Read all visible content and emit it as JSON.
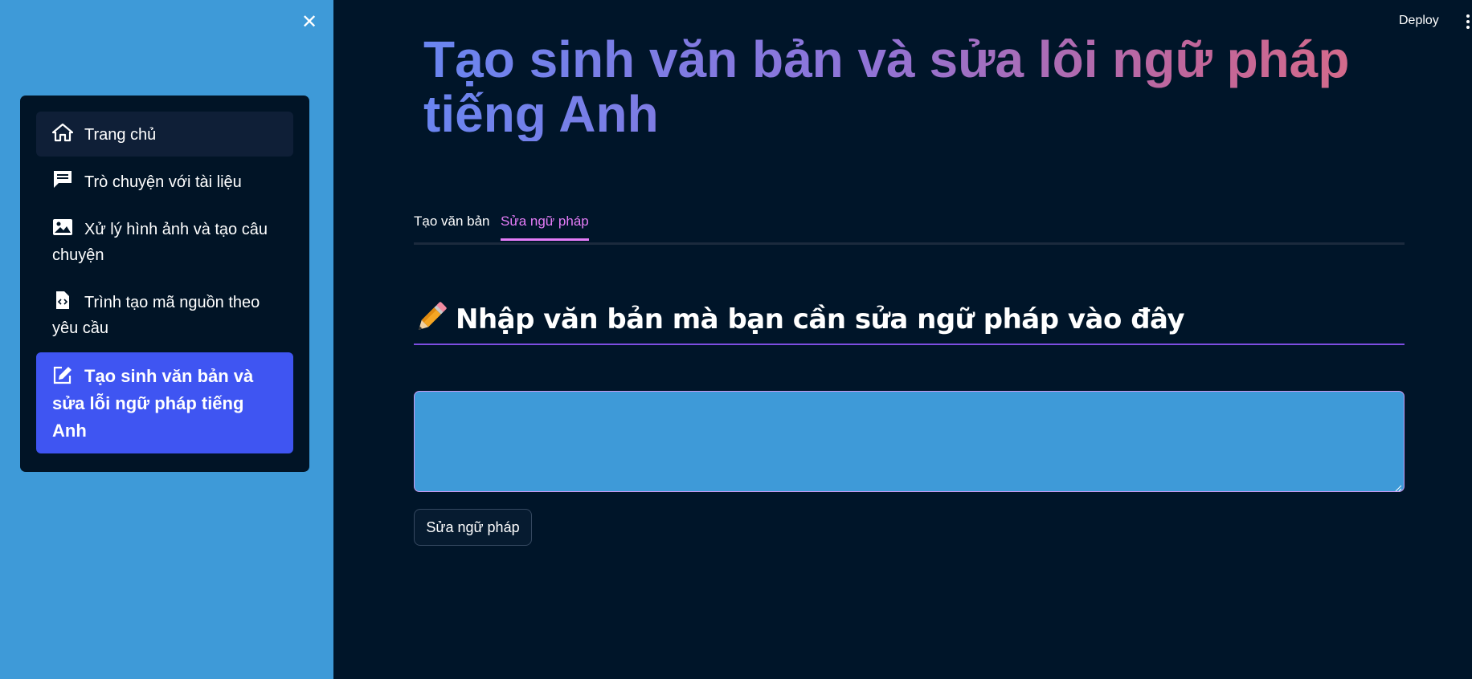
{
  "header": {
    "deploy_label": "Deploy"
  },
  "sidebar": {
    "close_glyph": "✕",
    "items": [
      {
        "label": "Trang chủ",
        "icon": "home-icon",
        "active": false
      },
      {
        "label": "Trò chuyện với tài liệu",
        "icon": "chat-icon",
        "active": false
      },
      {
        "label": "Xử lý hình ảnh và tạo câu chuyện",
        "icon": "image-icon",
        "active": false
      },
      {
        "label": "Trình tạo mã nguồn theo yêu cầu",
        "icon": "code-file-icon",
        "active": false
      },
      {
        "label": "Tạo sinh văn bản và sửa lỗi ngữ pháp tiếng Anh",
        "icon": "edit-icon",
        "active": true
      }
    ]
  },
  "main": {
    "title": "Tạo sinh văn bản và sửa lôi ngữ pháp tiếng Anh",
    "tabs": [
      {
        "label": "Tạo văn bản",
        "active": false
      },
      {
        "label": "Sửa ngữ pháp",
        "active": true
      }
    ],
    "section_heading": "Nhập văn bản mà bạn cần sửa ngữ pháp vào đây",
    "text_area_value": "",
    "submit_label": "Sửa ngữ pháp"
  },
  "colors": {
    "sidebar_bg": "#3e9ad8",
    "main_bg": "#001529",
    "menu_bg": "#011426",
    "active_item": "#3f55f2",
    "active_tab": "#e47cf7",
    "heading_underline": "#7d4de0"
  }
}
